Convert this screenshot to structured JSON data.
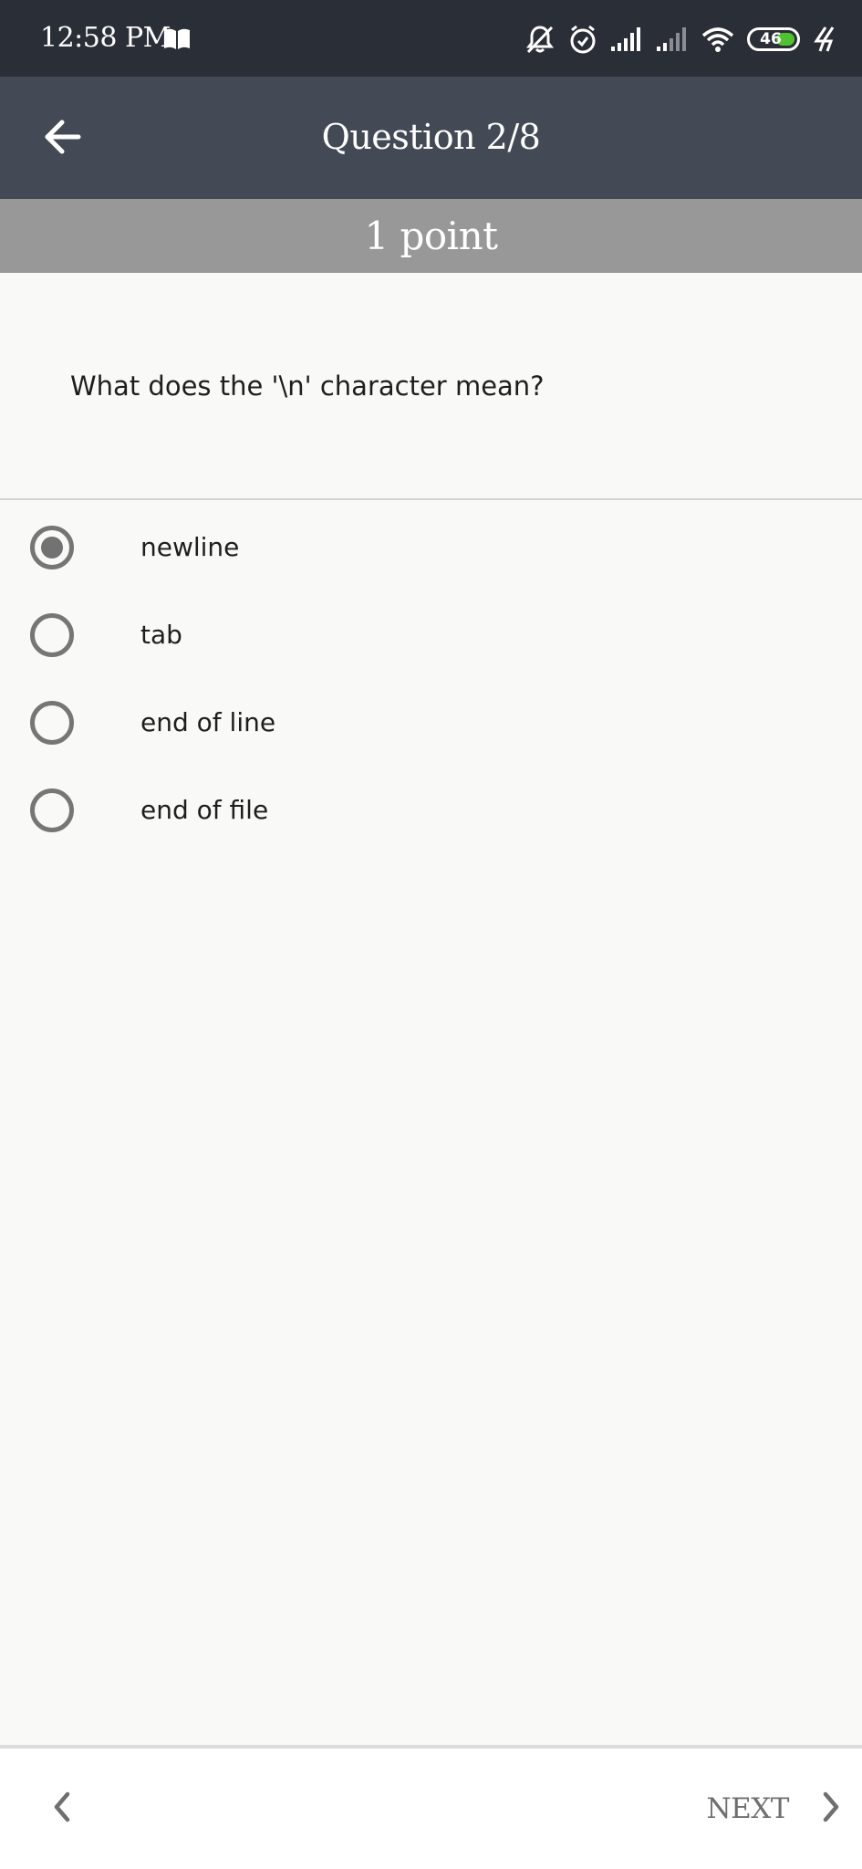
{
  "status_bar": {
    "time": "12:58 PM",
    "battery_level": "46",
    "icons": [
      "book-icon",
      "muted-bell-icon",
      "alarm-icon",
      "signal-icon",
      "signal-weak-icon",
      "wifi-icon",
      "battery-icon",
      "charging-icon"
    ]
  },
  "app_bar": {
    "title": "Question 2/8",
    "back_icon": "arrow-left-icon"
  },
  "points": {
    "label": "1 point"
  },
  "question": {
    "text": "What does the '\\n' character mean?"
  },
  "options": [
    {
      "label": "newline",
      "selected": true
    },
    {
      "label": "tab",
      "selected": false
    },
    {
      "label": "end of line",
      "selected": false
    },
    {
      "label": "end of file",
      "selected": false
    }
  ],
  "bottom_bar": {
    "next_label": "NEXT",
    "prev_icon": "chevron-left-icon",
    "next_icon": "chevron-right-icon"
  },
  "colors": {
    "status_bar": "#2a2e37",
    "app_bar": "#434a55",
    "points_bar": "#989898",
    "background": "#f9f9f8",
    "radio": "#767676",
    "battery_fill": "#4fc22f"
  }
}
